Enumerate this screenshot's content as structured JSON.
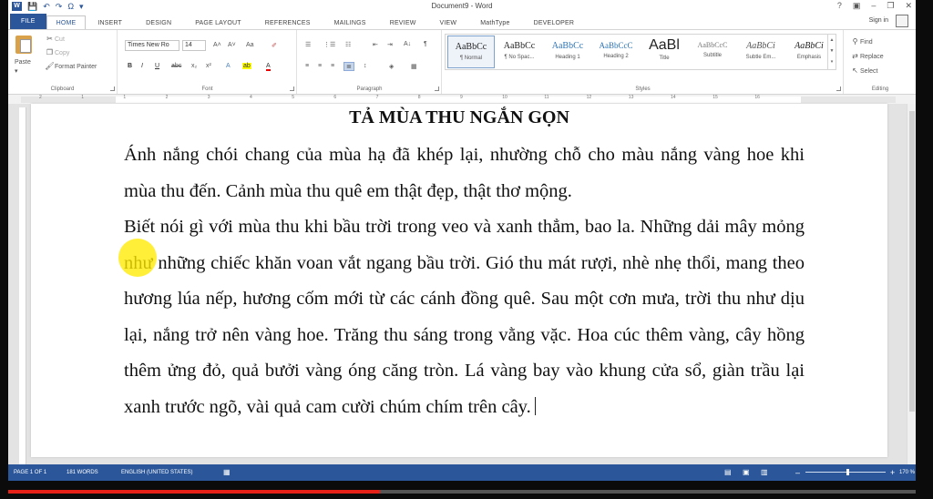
{
  "window": {
    "title": "Document9 - Word",
    "controls": [
      "?",
      "▣",
      "–",
      "❐",
      "✕"
    ]
  },
  "quick_access": [
    "💾",
    "↶",
    "↷",
    "Ω",
    "▾"
  ],
  "tabs": [
    {
      "label": "FILE"
    },
    {
      "label": "HOME"
    },
    {
      "label": "INSERT"
    },
    {
      "label": "DESIGN"
    },
    {
      "label": "PAGE LAYOUT"
    },
    {
      "label": "REFERENCES"
    },
    {
      "label": "MAILINGS"
    },
    {
      "label": "REVIEW"
    },
    {
      "label": "VIEW"
    },
    {
      "label": "MathType"
    },
    {
      "label": "DEVELOPER"
    }
  ],
  "signin": "Sign in",
  "ribbon": {
    "clipboard": {
      "label": "Clipboard",
      "paste": "Paste",
      "cut": "Cut",
      "copy": "Copy",
      "format_painter": "Format Painter"
    },
    "font": {
      "label": "Font",
      "font_name": "Times New Ro",
      "font_size": "14",
      "grow": "A˄",
      "shrink": "A˅",
      "case": "Aa",
      "clear": "✐",
      "bold": "B",
      "italic": "I",
      "underline": "U",
      "strike": "abc",
      "subscript": "x₂",
      "superscript": "x²",
      "effects": "A",
      "highlight": "ab",
      "font_color": "A"
    },
    "paragraph": {
      "label": "Paragraph",
      "bullets": "☰",
      "numbering": "⋮☰",
      "multilevel": "☷",
      "decrease_indent": "⇤",
      "increase_indent": "⇥",
      "sort": "A↓",
      "pilcrow": "¶",
      "align_left": "≡",
      "center": "≡",
      "align_right": "≡",
      "justify": "≣",
      "line_spacing": "↕",
      "shading": "◈",
      "borders": "▦"
    },
    "styles": {
      "label": "Styles",
      "items": [
        {
          "sample": "AaBbCc",
          "name": "¶ Normal"
        },
        {
          "sample": "AaBbCc",
          "name": "¶ No Spac..."
        },
        {
          "sample": "AaBbCc",
          "name": "Heading 1"
        },
        {
          "sample": "AaBbCcC",
          "name": "Heading 2"
        },
        {
          "sample": "AaBl",
          "name": "Title"
        },
        {
          "sample": "AaBbCcC",
          "name": "Subtitle"
        },
        {
          "sample": "AaBbCi",
          "name": "Subtle Em..."
        },
        {
          "sample": "AaBbCi",
          "name": "Emphasis"
        }
      ]
    },
    "editing": {
      "label": "Editing",
      "find": "Find",
      "replace": "Replace",
      "select": "Select"
    }
  },
  "ruler": {
    "labels": [
      "2",
      "1",
      "1",
      "2",
      "3",
      "4",
      "5",
      "6",
      "7",
      "8",
      "9",
      "10",
      "11",
      "12",
      "13",
      "14",
      "15",
      "16"
    ]
  },
  "document": {
    "heading": "TẢ MÙA THU NGẮN GỌN",
    "paragraphs": [
      "Ánh nắng chói chang của mùa hạ đã khép lại, nhường chỗ cho màu nắng vàng hoe khi mùa thu đến. Cảnh mùa thu quê em thật đẹp, thật thơ mộng.",
      "Biết nói gì với mùa thu khi bầu trời trong veo và xanh thẳm, bao la. Những dải mây mỏng như những chiếc khăn voan vắt ngang bầu trời. Gió thu mát rượi, nhè nhẹ thổi, mang theo hương lúa nếp, hương cốm mới từ các cánh đồng quê. Sau một cơn mưa, trời thu như dịu lại, nắng trở nên vàng hoe. Trăng thu sáng trong vằng vặc. Hoa cúc thêm vàng, cây hồng thêm ửng đỏ, quả bưởi vàng óng căng tròn. Lá vàng bay vào khung cửa sổ, giàn trầu lại xanh trước ngõ, vài quả cam cười chúm chím trên cây."
    ]
  },
  "statusbar": {
    "page": "PAGE 1 OF 1",
    "words": "181 WORDS",
    "language": "ENGLISH (UNITED STATES)",
    "zoom": "170 %",
    "zoom_out": "–",
    "zoom_in": "+"
  },
  "video": {
    "played_fraction": 0.41,
    "played_color": "#e62117"
  },
  "colors": {
    "word_blue": "#2b579a"
  }
}
